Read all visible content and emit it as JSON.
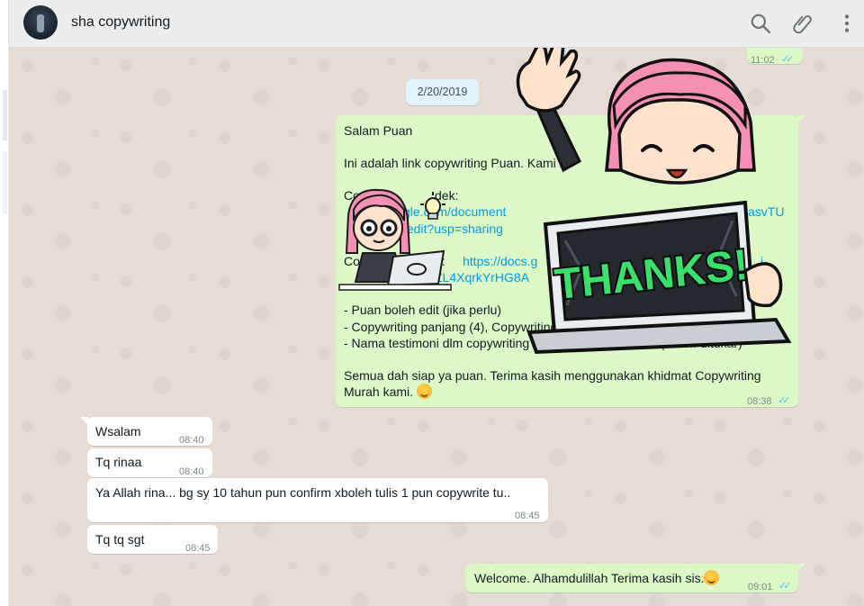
{
  "header": {
    "contact_name": "sha copywriting"
  },
  "icons": {
    "search": "search-icon",
    "attach": "paperclip-icon",
    "menu": "kebab-menu-icon"
  },
  "chat": {
    "top_partial_time": "11:02",
    "date_label": "2/20/2019",
    "main_message": {
      "l1": "Salam Puan",
      "l2": "Ini adalah link copywriting Puan. Kami h",
      "l3": "Co",
      "l3b": "dek:",
      "l4": "gle.com/document",
      "l4b": "asvTU",
      "l5": "/edit?usp=sharing",
      "l6": "Co",
      "l6b": "g:",
      "l6c": "https://docs.g",
      "l6d": "j-",
      "l7": "ZL4XqrkYrHG8A",
      "l8": "- Puan boleh edit (jika perlu)",
      "l9": "- Copywriting panjang (4), Copywriting pendek (6)",
      "l10": "- Nama testimoni dlm copywriting diletak secara random (Boleh ditukar)",
      "l11": "Semua dah siap ya puan. Terima kasih menggunakan khidmat Copywriting",
      "l12": "Murah kami.",
      "time": "08:38"
    },
    "sticker_text": "THANKS!",
    "incoming": [
      {
        "text": "Wsalam",
        "time": "08:40"
      },
      {
        "text": "Tq rinaa",
        "time": "08:40"
      },
      {
        "text": "Ya Allah rina... bg sy 10 tahun pun confirm xboleh tulis 1 pun copywrite tu..",
        "time": "08:45"
      },
      {
        "text": "Tq tq sgt",
        "time": "08:45"
      }
    ],
    "final_message": {
      "text": "Welcome. Alhamdulillah Terima kasih sis.",
      "time": "09:01"
    }
  },
  "colors": {
    "outgoing_bubble": "#dcf8c6",
    "incoming_bubble": "#ffffff",
    "read_ticks": "#4fc3f7",
    "link": "#039be5",
    "header_bg": "#ededed"
  }
}
